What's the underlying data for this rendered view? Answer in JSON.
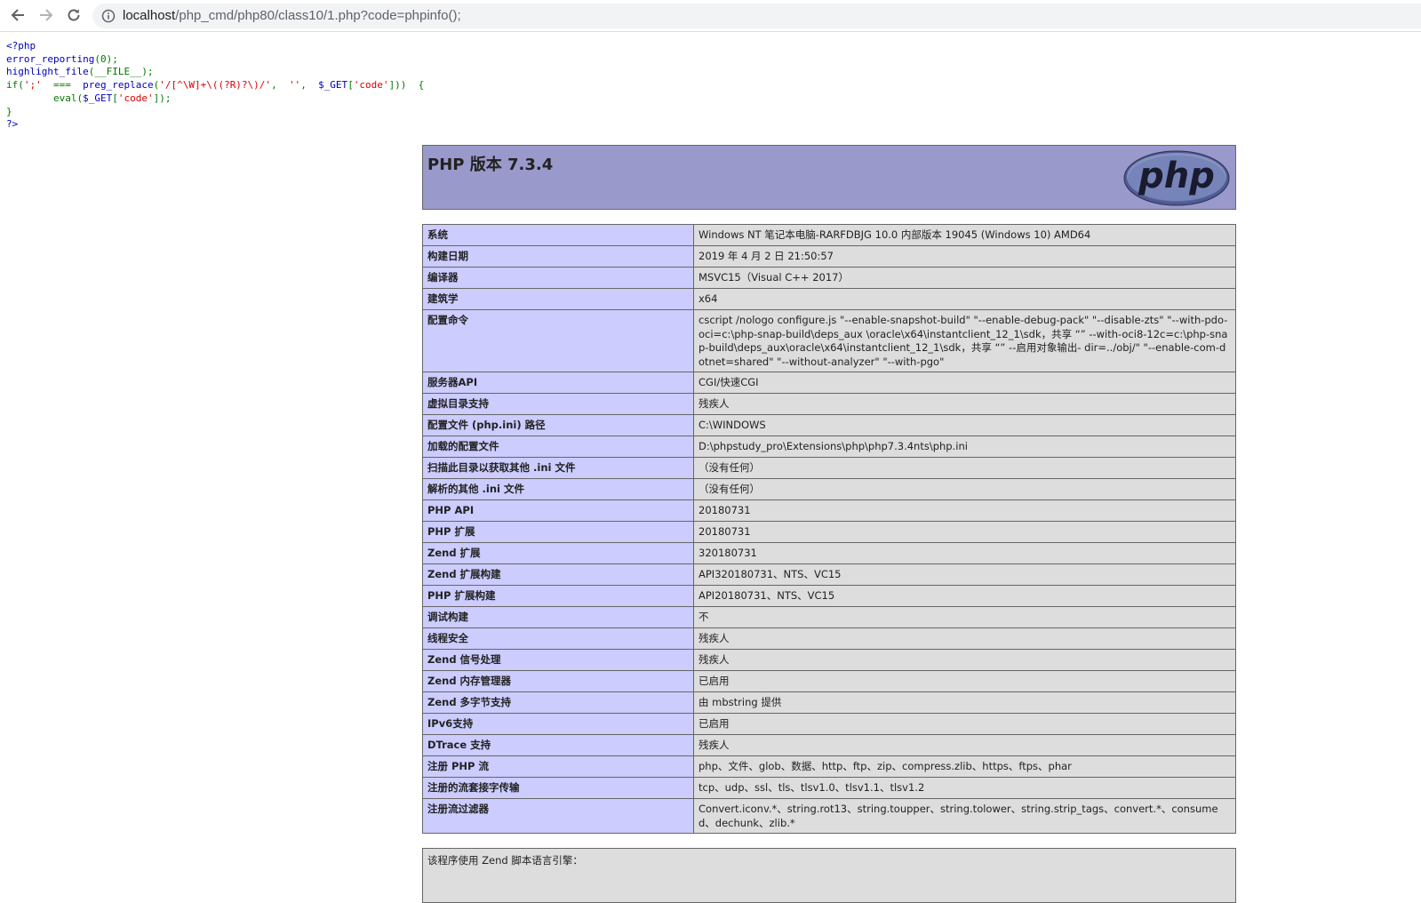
{
  "browser": {
    "url_host": "localhost",
    "url_path": "/php_cmd/php80/class10/1.php?code=phpinfo();"
  },
  "source_code": {
    "line1": "<?php",
    "line2_fn": "error_reporting",
    "line2_rest": "(0);",
    "line3_fn": "highlight_file",
    "line3_rest": "(__FILE__);",
    "line4_if": "if(",
    "line4_str1": "';'",
    "line4_op": "  ===  ",
    "line4_fn": "preg_replace",
    "line4_paren": "(",
    "line4_str2": "'/[^\\W]+\\((?R)?\\)/'",
    "line4_comma1": ",  ",
    "line4_str3": "''",
    "line4_comma2": ",  ",
    "line4_var": "$_GET",
    "line4_br": "[",
    "line4_str4": "'code'",
    "line4_end": "]))  {",
    "line5_indent": "        ",
    "line5_eval": "eval(",
    "line5_var": "$_GET",
    "line5_br": "[",
    "line5_str": "'code'",
    "line5_end": "]);",
    "line6": "}",
    "line7": "?>"
  },
  "phpinfo": {
    "title": "PHP 版本 7.3.4",
    "logo_text": "php",
    "rows": [
      {
        "label": "系统",
        "value": "Windows NT 笔记本电脑-RARFDBJG 10.0 内部版本 19045 (Windows 10) AMD64"
      },
      {
        "label": "构建日期",
        "value": "2019 年 4 月 2 日 21:50:57"
      },
      {
        "label": "编译器",
        "value": "MSVC15（Visual C++ 2017）"
      },
      {
        "label": "建筑学",
        "value": "x64"
      },
      {
        "label": "配置命令",
        "value": "cscript /nologo configure.js \"--enable-snapshot-build\" \"--enable-debug-pack\" \"--disable-zts\" \"--with-pdo-oci=c:\\php-snap-build\\deps_aux \\oracle\\x64\\instantclient_12_1\\sdk，共享 “” --with-oci8-12c=c:\\php-snap-build\\deps_aux\\oracle\\x64\\instantclient_12_1\\sdk，共享 “” --启用对象输出- dir=../obj/\" \"--enable-com-dotnet=shared\" \"--without-analyzer\" \"--with-pgo\""
      },
      {
        "label": "服务器API",
        "value": "CGI/快速CGI"
      },
      {
        "label": "虚拟目录支持",
        "value": "残疾人"
      },
      {
        "label": "配置文件 (php.ini) 路径",
        "value": "C:\\WINDOWS"
      },
      {
        "label": "加载的配置文件",
        "value": "D:\\phpstudy_pro\\Extensions\\php\\php7.3.4nts\\php.ini"
      },
      {
        "label": "扫描此目录以获取其他 .ini 文件",
        "value": "（没有任何）"
      },
      {
        "label": "解析的其他 .ini 文件",
        "value": "（没有任何）"
      },
      {
        "label": "PHP API",
        "value": "20180731"
      },
      {
        "label": "PHP 扩展",
        "value": "20180731"
      },
      {
        "label": "Zend 扩展",
        "value": "320180731"
      },
      {
        "label": "Zend 扩展构建",
        "value": "API320180731、NTS、VC15"
      },
      {
        "label": "PHP 扩展构建",
        "value": "API20180731、NTS、VC15"
      },
      {
        "label": "调试构建",
        "value": "不"
      },
      {
        "label": "线程安全",
        "value": "残疾人"
      },
      {
        "label": "Zend 信号处理",
        "value": "残疾人"
      },
      {
        "label": "Zend 内存管理器",
        "value": "已启用"
      },
      {
        "label": "Zend 多字节支持",
        "value": "由 mbstring 提供"
      },
      {
        "label": "IPv6支持",
        "value": "已启用"
      },
      {
        "label": "DTrace 支持",
        "value": "残疾人"
      },
      {
        "label": "注册 PHP 流",
        "value": "php、文件、glob、数据、http、ftp、zip、compress.zlib、https、ftps、phar"
      },
      {
        "label": "注册的流套接字传输",
        "value": "tcp、udp、ssl、tls、tlsv1.0、tlsv1.1、tlsv1.2"
      },
      {
        "label": "注册流过滤器",
        "value": "Convert.iconv.*、string.rot13、string.toupper、string.tolower、string.strip_tags、convert.*、consumed、dechunk、zlib.*"
      }
    ],
    "footer_text": "该程序使用 Zend 脚本语言引擎："
  },
  "colors": {
    "header_bg": "#9999cc",
    "label_bg": "#ccccff",
    "value_bg": "#dddddd",
    "keyword": "#007700",
    "function": "#0000bb",
    "string": "#dd0000"
  },
  "icons": {
    "back": "arrow-left-icon",
    "forward": "arrow-right-icon",
    "reload": "reload-icon",
    "site_info": "info-circle-icon"
  }
}
